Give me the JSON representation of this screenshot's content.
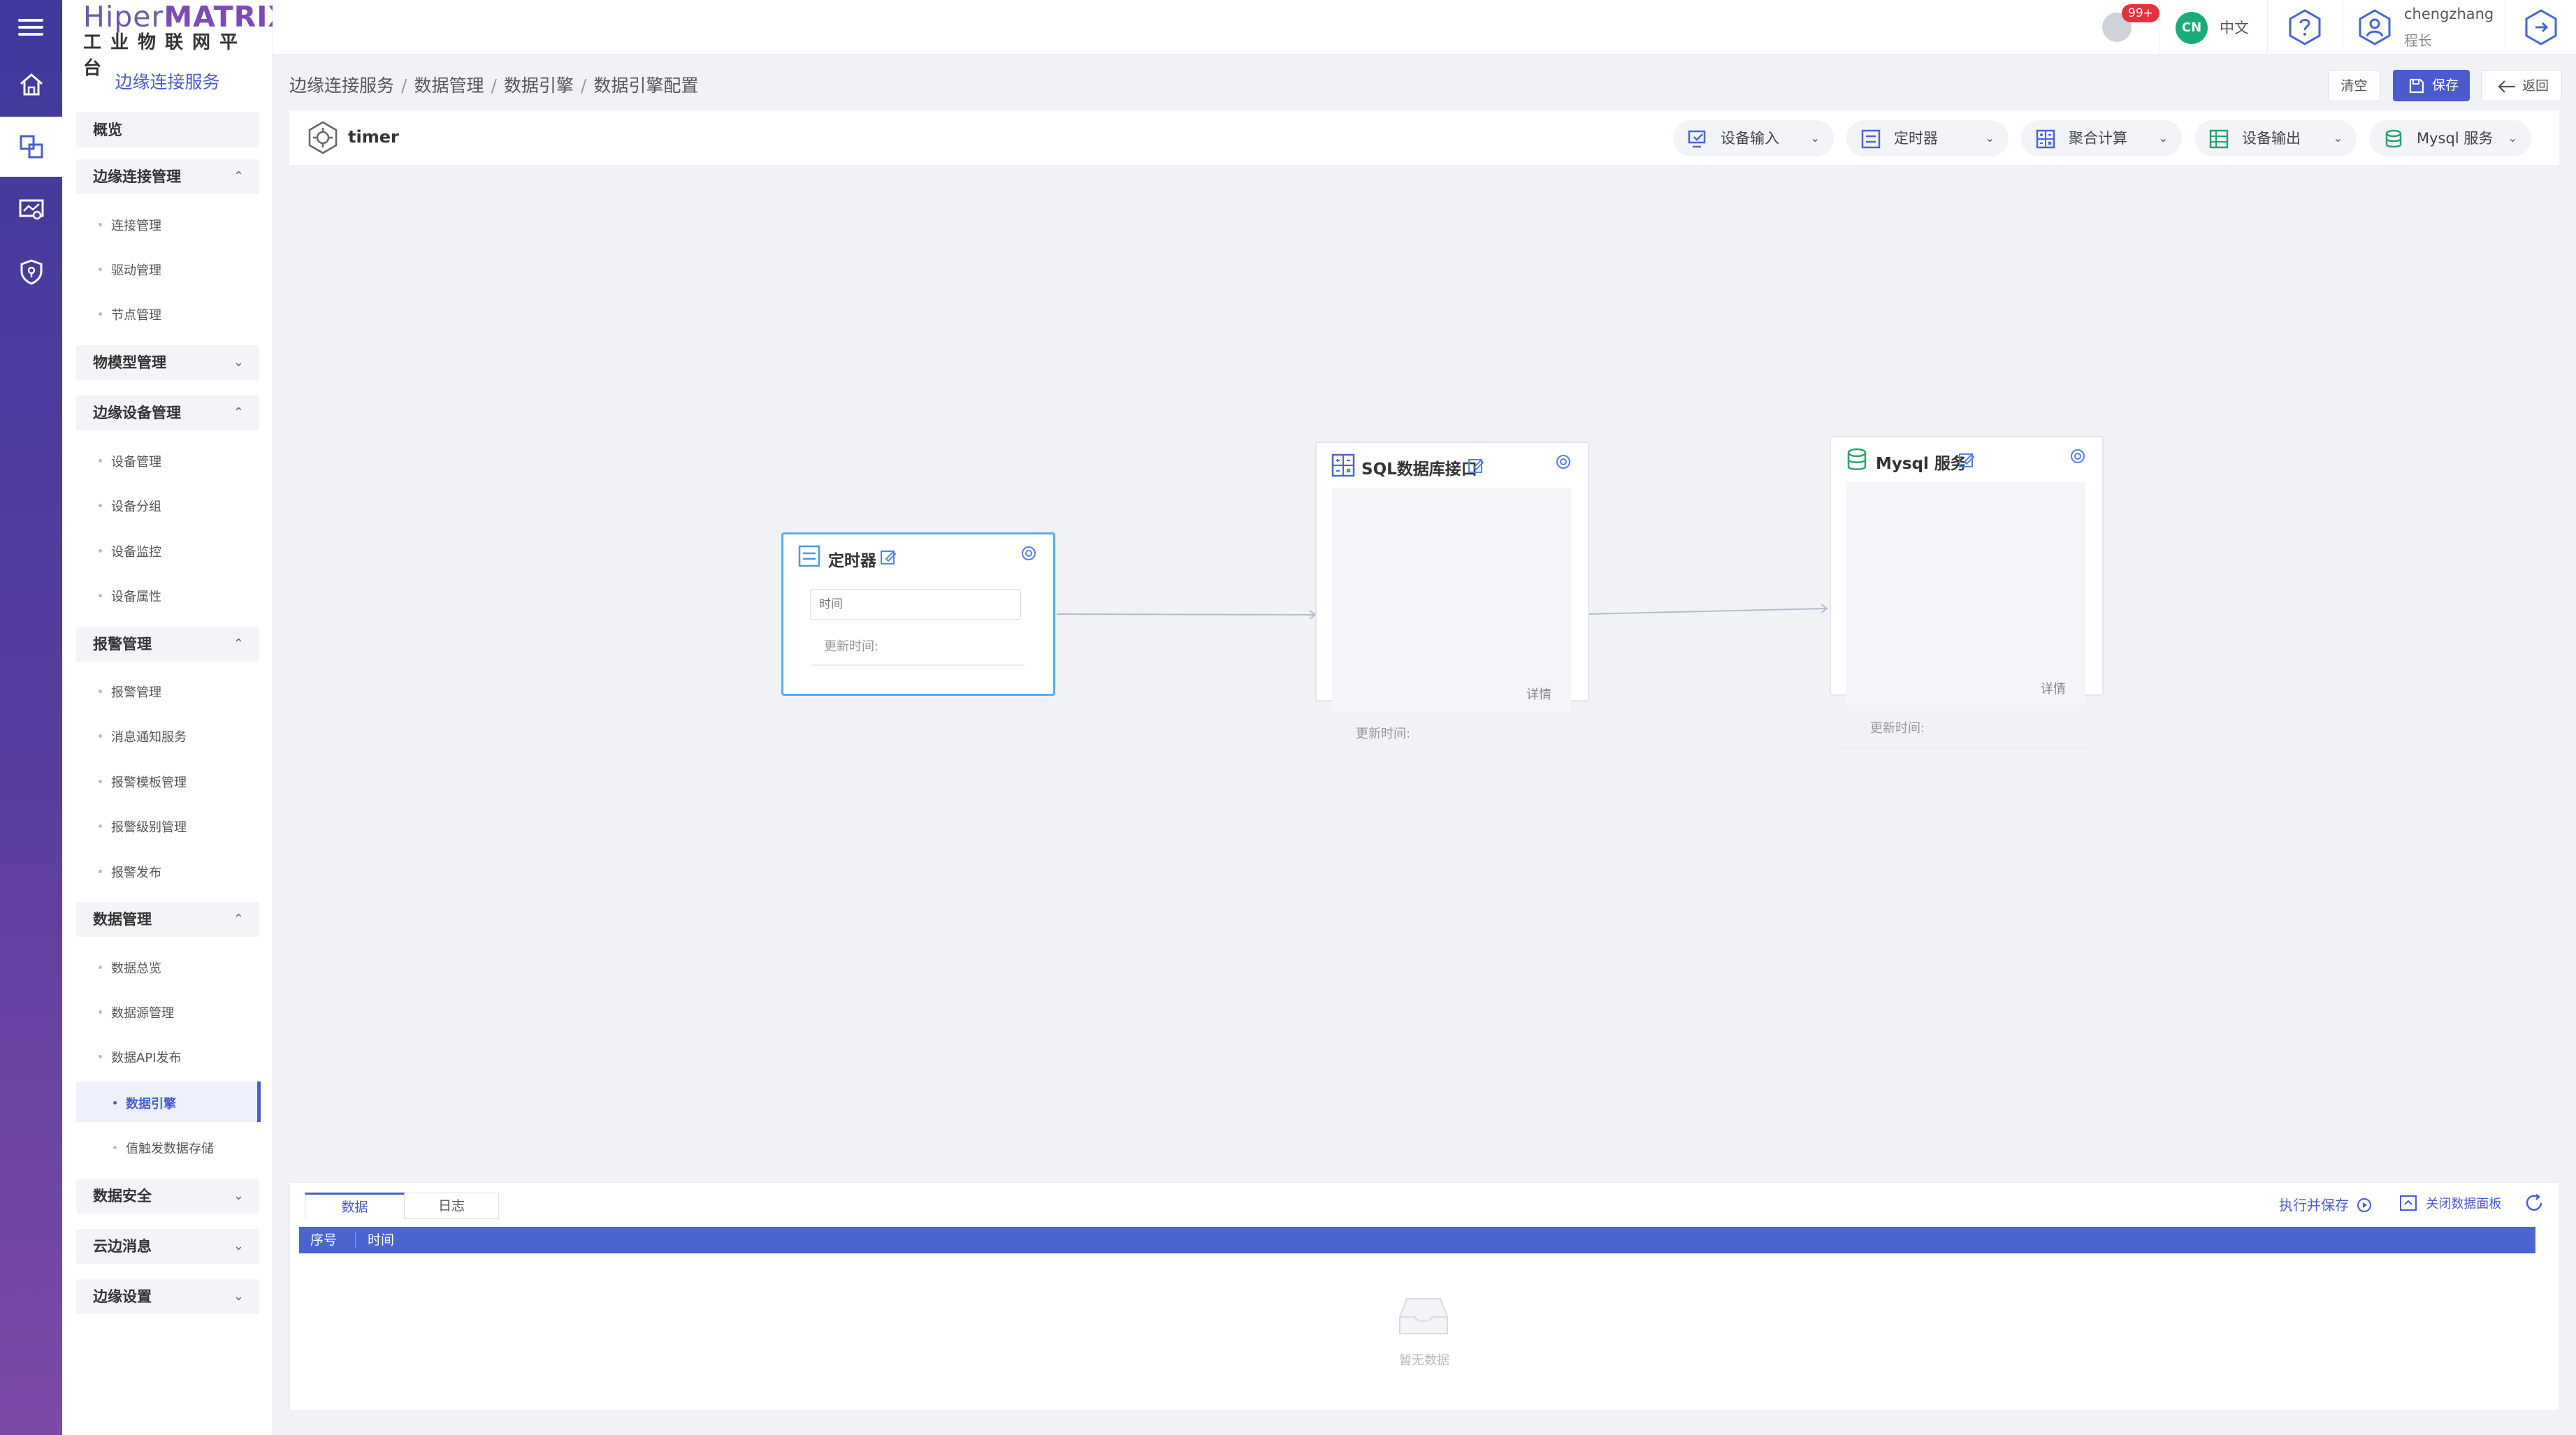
{
  "app": {
    "logo_prefix": "Hiper",
    "logo_brand": "MATRIX",
    "logo_sub": "工业物联网平台"
  },
  "sidebar": {
    "title": "边缘连接服务",
    "groups": [
      {
        "label": "概览",
        "chevron": ""
      },
      {
        "label": "边缘连接管理",
        "chevron": "⌃",
        "items": [
          "连接管理",
          "驱动管理",
          "节点管理"
        ]
      },
      {
        "label": "物模型管理",
        "chevron": "⌄"
      },
      {
        "label": "边缘设备管理",
        "chevron": "⌃",
        "items": [
          "设备管理",
          "设备分组",
          "设备监控",
          "设备属性"
        ]
      },
      {
        "label": "报警管理",
        "chevron": "⌃",
        "items": [
          "报警管理",
          "消息通知服务",
          "报警模板管理",
          "报警级别管理",
          "报警发布"
        ]
      },
      {
        "label": "数据管理",
        "chevron": "⌃",
        "items": [
          "数据总览",
          "数据源管理",
          "数据API发布",
          "数据引擎",
          "值触发数据存储"
        ]
      },
      {
        "label": "数据安全",
        "chevron": "⌄"
      },
      {
        "label": "云边消息",
        "chevron": "⌄"
      },
      {
        "label": "边缘设置",
        "chevron": "⌄"
      }
    ]
  },
  "header": {
    "badge": "99+",
    "lang_code": "CN",
    "lang_label": "中文",
    "user_name": "chengzhang",
    "user_role": "程长"
  },
  "breadcrumb": [
    "边缘连接服务",
    "数据管理",
    "数据引擎",
    "数据引擎配置"
  ],
  "actions": {
    "clear": "清空",
    "save": "保存",
    "back": "返回"
  },
  "flow": {
    "name": "timer",
    "toolbar": [
      "设备输入",
      "定时器",
      "聚合计算",
      "设备输出",
      "Mysql 服务"
    ],
    "nodes": {
      "timer": {
        "title": "定时器",
        "field_placeholder": "时间",
        "update_label": "更新时间:"
      },
      "sql": {
        "title": "SQL数据库接口",
        "detail": "详情",
        "update_label": "更新时间:"
      },
      "mysql": {
        "title": "Mysql 服务",
        "detail": "详情",
        "update_label": "更新时间:"
      }
    }
  },
  "panel": {
    "tabs": [
      "数据",
      "日志"
    ],
    "exec_save": "执行并保存",
    "close_panel": "关闭数据面板",
    "columns": [
      "序号",
      "时间"
    ],
    "empty": "暂无数据"
  },
  "colors": {
    "primary": "#4a5bd1",
    "rail_top": "#3f3a9c",
    "rail_bottom": "#7a4aa8",
    "badge": "#e3323b",
    "cn": "#1aab7a",
    "selected_node": "#5aa9f2"
  }
}
